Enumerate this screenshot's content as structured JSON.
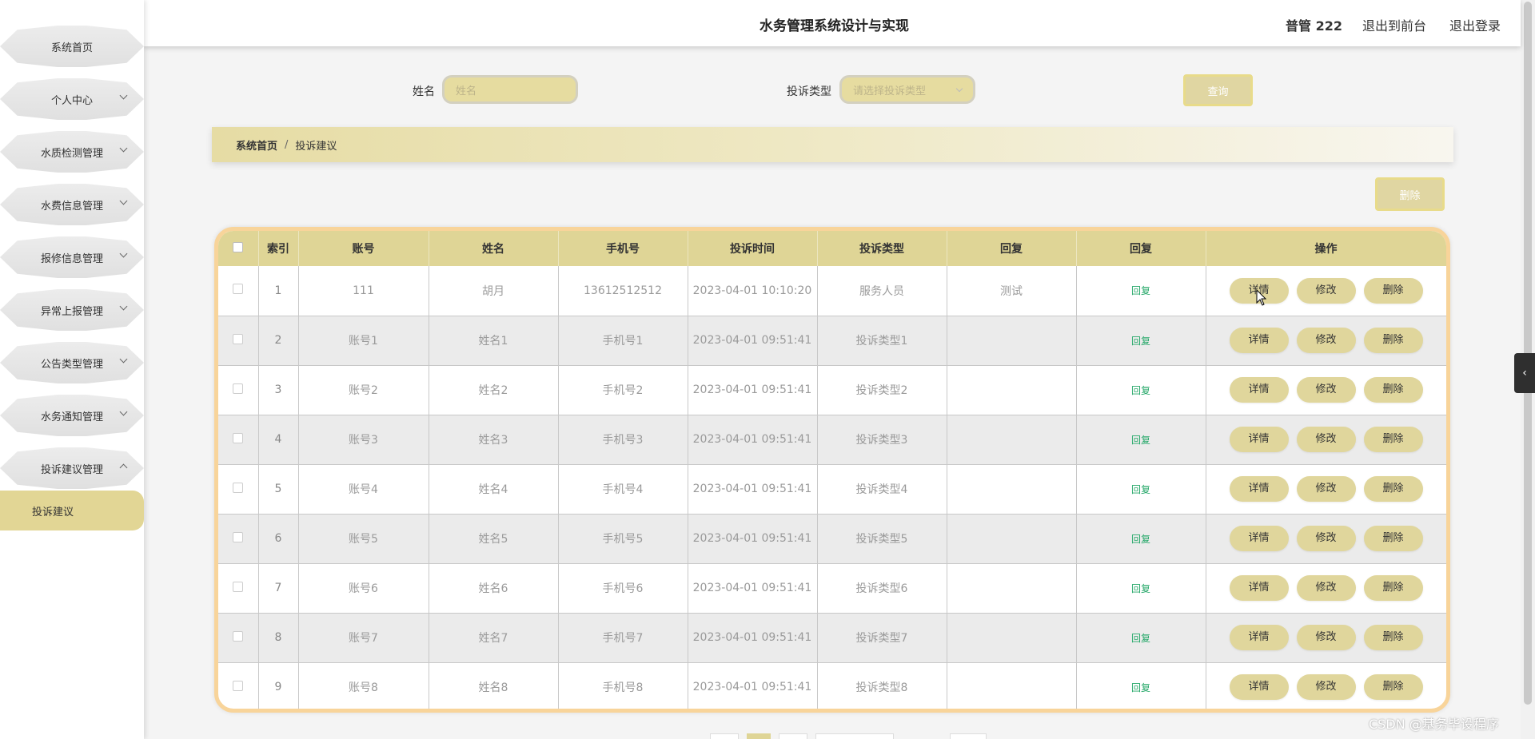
{
  "app": {
    "title": "水务管理系统设计与实现",
    "user": "普管 222",
    "link_front": "退出到前台",
    "link_logout": "退出登录"
  },
  "sidebar": {
    "items": [
      {
        "label": "系统首页",
        "icon": "none"
      },
      {
        "label": "个人中心",
        "icon": "chevron-down-icon"
      },
      {
        "label": "水质检测管理",
        "icon": "chevron-down-icon"
      },
      {
        "label": "水费信息管理",
        "icon": "chevron-down-icon"
      },
      {
        "label": "报修信息管理",
        "icon": "chevron-down-icon"
      },
      {
        "label": "异常上报管理",
        "icon": "chevron-down-icon"
      },
      {
        "label": "公告类型管理",
        "icon": "chevron-down-icon"
      },
      {
        "label": "水务通知管理",
        "icon": "chevron-down-icon"
      },
      {
        "label": "投诉建议管理",
        "icon": "chevron-up-icon"
      }
    ],
    "active_sub": "投诉建议",
    "active_color": "#e2d695"
  },
  "search": {
    "name_label": "姓名",
    "name_placeholder": "姓名",
    "type_label": "投诉类型",
    "type_placeholder": "请选择投诉类型",
    "query_button": "查询"
  },
  "breadcrumb": {
    "home": "系统首页",
    "sep": "/",
    "current": "投诉建议"
  },
  "toolbar": {
    "delete_button": "删除"
  },
  "table": {
    "headers": [
      "",
      "索引",
      "账号",
      "姓名",
      "手机号",
      "投诉时间",
      "投诉类型",
      "回复",
      "回复",
      "操作"
    ],
    "rows": [
      {
        "index": "1",
        "account": "111",
        "name": "胡月",
        "phone": "13612512512",
        "time": "2023-04-01 10:10:20",
        "type": "服务人员",
        "reply_text": "测试",
        "reply_link": "回复"
      },
      {
        "index": "2",
        "account": "账号1",
        "name": "姓名1",
        "phone": "手机号1",
        "time": "2023-04-01 09:51:41",
        "type": "投诉类型1",
        "reply_text": "",
        "reply_link": "回复"
      },
      {
        "index": "3",
        "account": "账号2",
        "name": "姓名2",
        "phone": "手机号2",
        "time": "2023-04-01 09:51:41",
        "type": "投诉类型2",
        "reply_text": "",
        "reply_link": "回复"
      },
      {
        "index": "4",
        "account": "账号3",
        "name": "姓名3",
        "phone": "手机号3",
        "time": "2023-04-01 09:51:41",
        "type": "投诉类型3",
        "reply_text": "",
        "reply_link": "回复"
      },
      {
        "index": "5",
        "account": "账号4",
        "name": "姓名4",
        "phone": "手机号4",
        "time": "2023-04-01 09:51:41",
        "type": "投诉类型4",
        "reply_text": "",
        "reply_link": "回复"
      },
      {
        "index": "6",
        "account": "账号5",
        "name": "姓名5",
        "phone": "手机号5",
        "time": "2023-04-01 09:51:41",
        "type": "投诉类型5",
        "reply_text": "",
        "reply_link": "回复"
      },
      {
        "index": "7",
        "account": "账号6",
        "name": "姓名6",
        "phone": "手机号6",
        "time": "2023-04-01 09:51:41",
        "type": "投诉类型6",
        "reply_text": "",
        "reply_link": "回复"
      },
      {
        "index": "8",
        "account": "账号7",
        "name": "姓名7",
        "phone": "手机号7",
        "time": "2023-04-01 09:51:41",
        "type": "投诉类型7",
        "reply_text": "",
        "reply_link": "回复"
      },
      {
        "index": "9",
        "account": "账号8",
        "name": "姓名8",
        "phone": "手机号8",
        "time": "2023-04-01 09:51:41",
        "type": "投诉类型8",
        "reply_text": "",
        "reply_link": "回复"
      }
    ],
    "actions": {
      "detail": "详情",
      "edit": "修改",
      "delete": "删除"
    }
  },
  "watermark": "CSDN @基务毕设程序",
  "colors": {
    "accent": "#dfd596",
    "table_border": "#f8d49a",
    "reply_link": "#26a869"
  }
}
